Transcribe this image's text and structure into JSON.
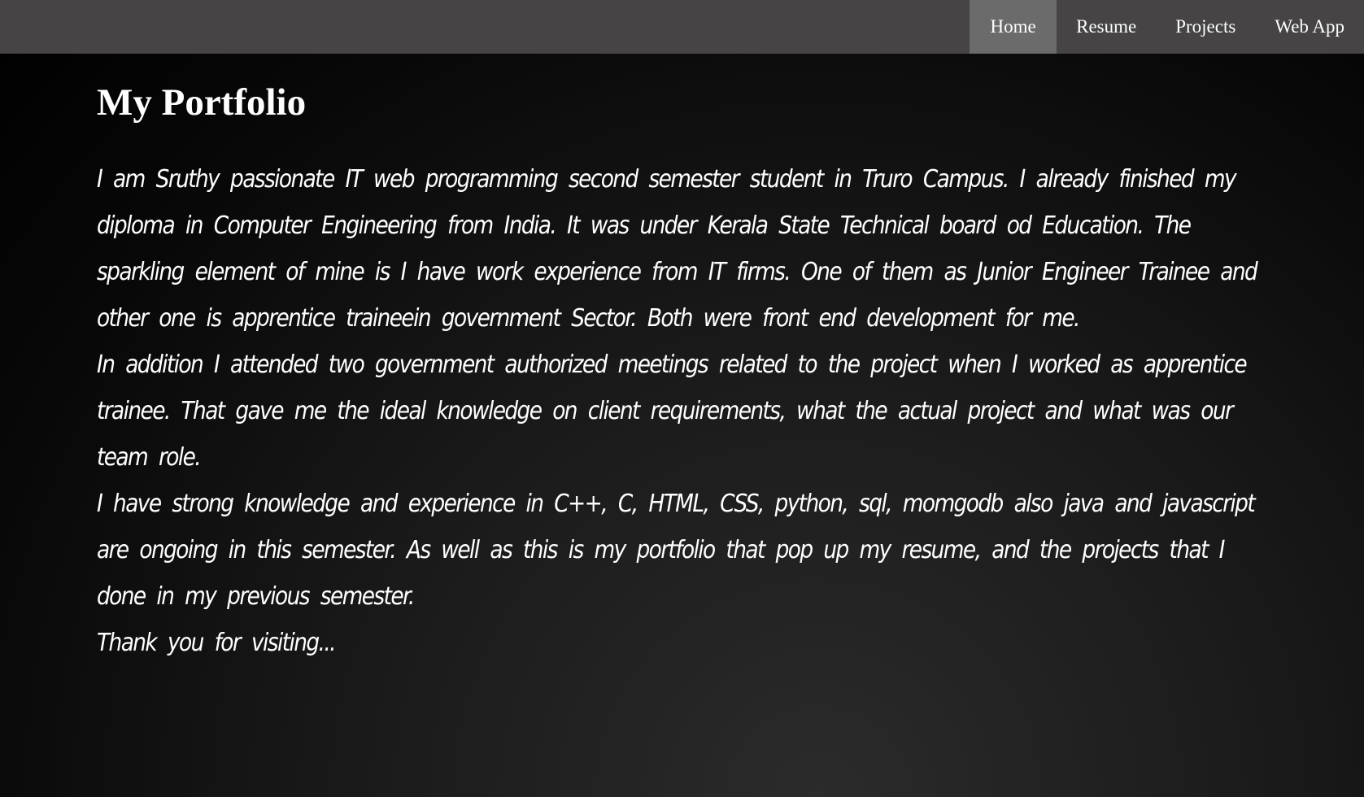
{
  "nav": {
    "items": [
      {
        "label": "Home",
        "active": true
      },
      {
        "label": "Resume",
        "active": false
      },
      {
        "label": "Projects",
        "active": false
      },
      {
        "label": "Web App",
        "active": false
      }
    ]
  },
  "main": {
    "title": "My Portfolio",
    "paragraphs": [
      "I am Sruthy passionate IT web programming second semester student in Truro Campus. I already finished my diploma in Computer Engineering from India. It was under Kerala State Technical board od Education. The sparkling element of mine is I have work experience from IT firms. One of them as Junior Engineer Trainee and other one is apprentice traineein government Sector. Both were front end development for me.",
      "In addition I attended two government authorized meetings related to the project when I worked as apprentice trainee. That gave me the ideal knowledge on client requirements, what the actual project and what was our team role.",
      "I have strong knowledge and experience in C++, C, HTML, CSS, python, sql, momgodb also java and javascript are ongoing in this semester. As well as this is my portfolio that pop up my resume, and the projects that I done in my previous semester.",
      "Thank you for visiting..."
    ]
  },
  "colors": {
    "nav_bg": "#464444",
    "nav_active_bg": "#6b6b6b",
    "text": "#ffffff",
    "page_bg": "#000000"
  }
}
